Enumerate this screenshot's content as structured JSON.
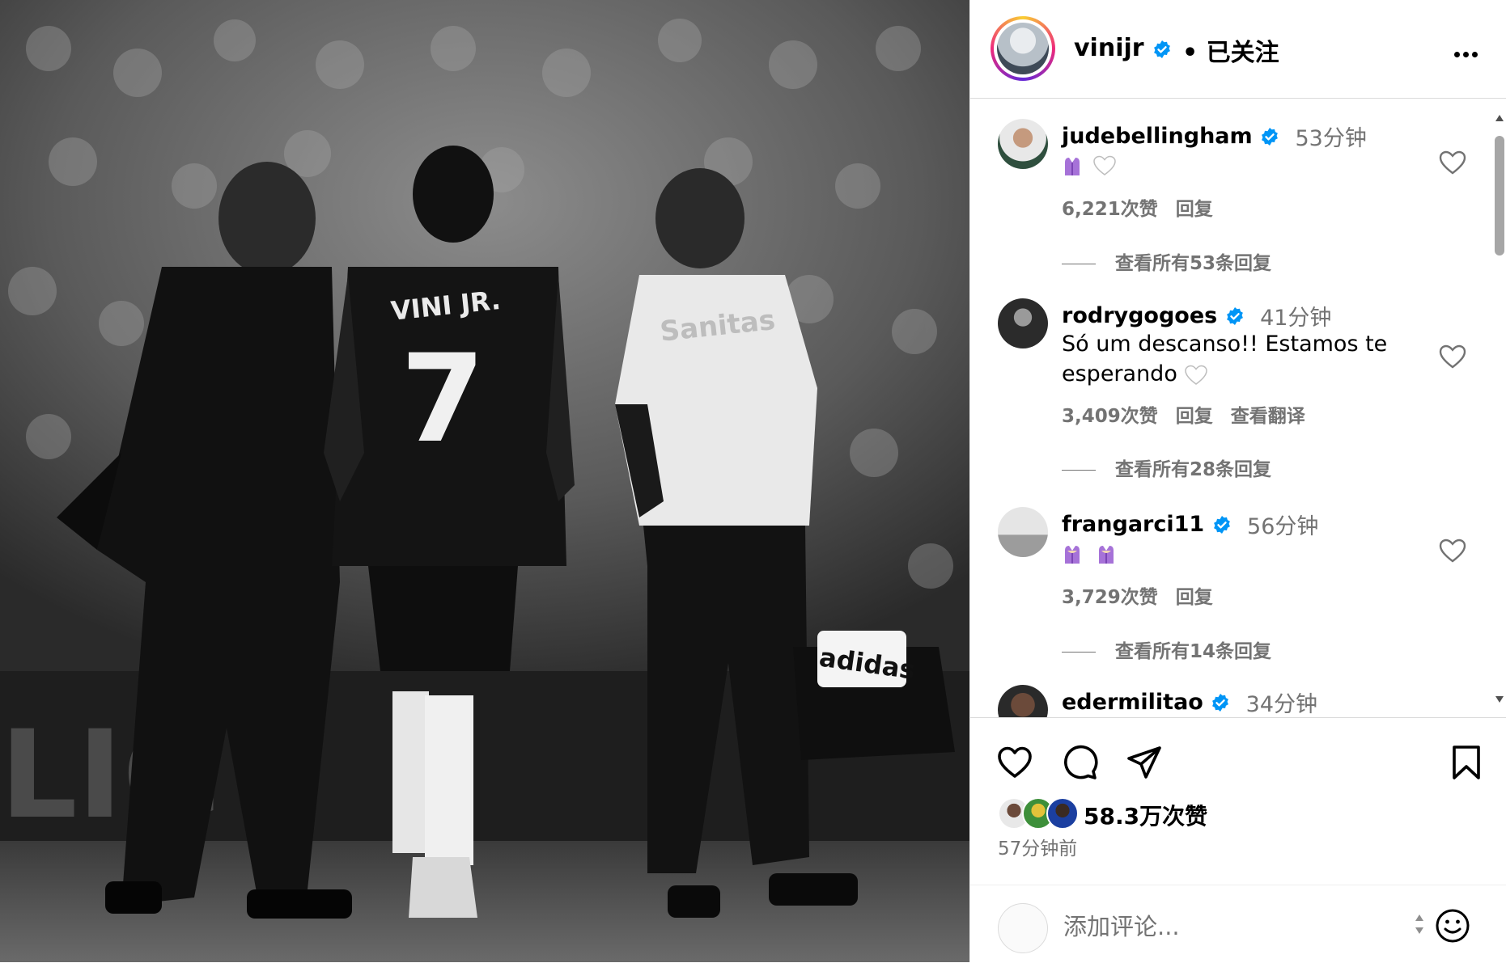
{
  "post": {
    "username": "vinijr",
    "follow_status": "• 已关注",
    "jersey_name": "VINI JR.",
    "jersey_number": "7",
    "sponsor": "Sanitas",
    "bag_brand": "adidas"
  },
  "comments": [
    {
      "username": "judebellingham",
      "time": "53分钟",
      "text": "",
      "likes": "6,221次赞",
      "reply": "回复",
      "translate": "",
      "view_replies": "查看所有53条回复"
    },
    {
      "username": "rodrygogoes",
      "time": "41分钟",
      "text": "Só um descanso!! Estamos te esperando",
      "likes": "3,409次赞",
      "reply": "回复",
      "translate": "查看翻译",
      "view_replies": "查看所有28条回复"
    },
    {
      "username": "frangarci11",
      "time": "56分钟",
      "text": "",
      "likes": "3,729次赞",
      "reply": "回复",
      "translate": "",
      "view_replies": "查看所有14条回复"
    },
    {
      "username": "edermilitao",
      "time": "34分钟"
    }
  ],
  "actions": {
    "likes_count": "58.3万次赞",
    "posted_ago": "57分钟前",
    "comment_placeholder": "添加评论..."
  },
  "colors": {
    "verified": "#0095f6",
    "secondary_text": "#737373",
    "divider": "#dbdbdb",
    "hands_emoji": "#a672d8"
  },
  "icons": [
    "verified-badge-icon",
    "more-options-icon",
    "heart-icon",
    "comment-icon",
    "share-icon",
    "bookmark-icon",
    "emoji-icon",
    "purple-heart-hands-icon",
    "white-heart-icon"
  ]
}
